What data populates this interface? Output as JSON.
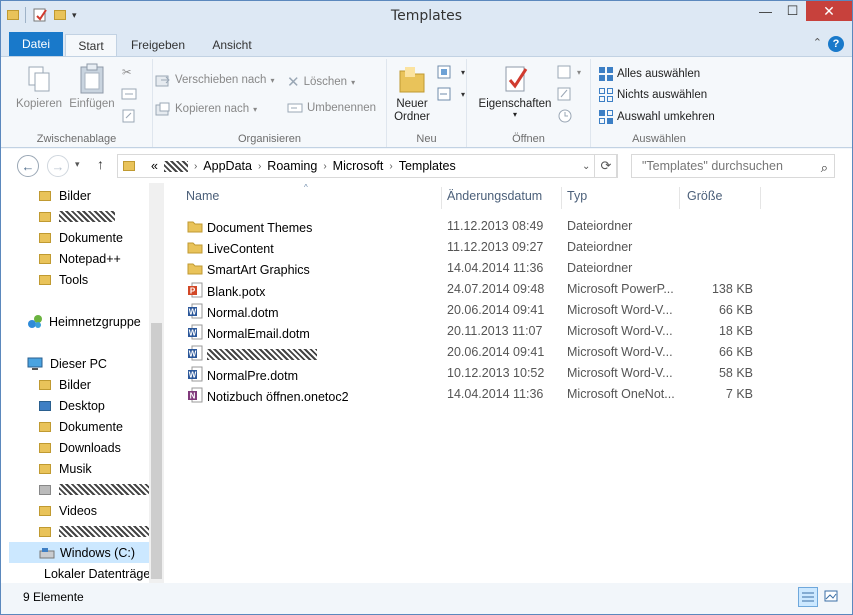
{
  "window": {
    "title": "Templates"
  },
  "ribbon_tabs": [
    "Datei",
    "Start",
    "Freigeben",
    "Ansicht"
  ],
  "clipboard": {
    "copy": "Kopieren",
    "paste": "Einfügen",
    "label": "Zwischenablage"
  },
  "organize": {
    "move": "Verschieben nach",
    "copy_to": "Kopieren nach",
    "delete": "Löschen",
    "rename": "Umbenennen",
    "label": "Organisieren"
  },
  "new": {
    "folder": "Neuer Ordner",
    "label": "Neu"
  },
  "open": {
    "properties": "Eigenschaften",
    "label": "Öffnen"
  },
  "select": {
    "all": "Alles auswählen",
    "none": "Nichts auswählen",
    "invert": "Auswahl umkehren",
    "label": "Auswählen"
  },
  "address": {
    "overflow": "«",
    "crumbs": [
      "AppData",
      "Roaming",
      "Microsoft",
      "Templates"
    ]
  },
  "search": {
    "placeholder": "\"Templates\" durchsuchen"
  },
  "nav": {
    "quick": [
      "Bilder",
      "Dokumente",
      "Notepad++",
      "Tools"
    ],
    "homegroup": "Heimnetzgruppe",
    "pc": "Dieser PC",
    "pc_items": [
      "Bilder",
      "Desktop",
      "Dokumente",
      "Downloads",
      "Musik",
      "Videos",
      "Windows (C:)",
      "Lokaler Datenträger"
    ]
  },
  "columns": {
    "name": "Name",
    "date": "Änderungsdatum",
    "type": "Typ",
    "size": "Größe"
  },
  "files": [
    {
      "name": "Document Themes",
      "date": "11.12.2013 08:49",
      "type": "Dateiordner",
      "size": "",
      "icon": "folder"
    },
    {
      "name": "LiveContent",
      "date": "11.12.2013 09:27",
      "type": "Dateiordner",
      "size": "",
      "icon": "folder"
    },
    {
      "name": "SmartArt Graphics",
      "date": "14.04.2014 11:36",
      "type": "Dateiordner",
      "size": "",
      "icon": "folder"
    },
    {
      "name": "Blank.potx",
      "date": "24.07.2014 09:48",
      "type": "Microsoft PowerP...",
      "size": "138 KB",
      "icon": "ppt"
    },
    {
      "name": "Normal.dotm",
      "date": "20.06.2014 09:41",
      "type": "Microsoft Word-V...",
      "size": "66 KB",
      "icon": "word"
    },
    {
      "name": "NormalEmail.dotm",
      "date": "20.11.2013 11:07",
      "type": "Microsoft Word-V...",
      "size": "18 KB",
      "icon": "word"
    },
    {
      "name": "",
      "date": "20.06.2014 09:41",
      "type": "Microsoft Word-V...",
      "size": "66 KB",
      "icon": "word"
    },
    {
      "name": "NormalPre.dotm",
      "date": "10.12.2013 10:52",
      "type": "Microsoft Word-V...",
      "size": "58 KB",
      "icon": "word"
    },
    {
      "name": "Notizbuch öffnen.onetoc2",
      "date": "14.04.2014 11:36",
      "type": "Microsoft OneNot...",
      "size": "7 KB",
      "icon": "onenote"
    }
  ],
  "status": {
    "count": "9 Elemente"
  },
  "colors": {
    "accent": "#1979ca",
    "folder": "#e9c35a",
    "word": "#2b579a",
    "ppt": "#d24726",
    "onenote": "#80397b"
  }
}
